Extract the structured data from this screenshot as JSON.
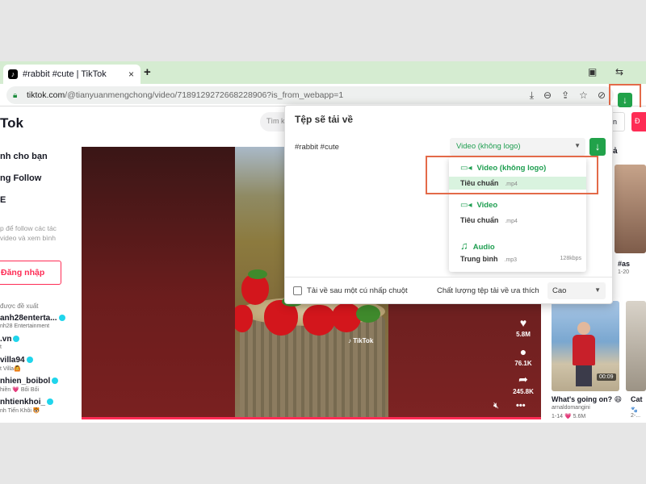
{
  "browser": {
    "tab_title": "#rabbit #cute | TikTok",
    "tab_close": "×",
    "new_tab": "+",
    "url_host": "tiktok.com",
    "url_path": "/@tianyuanmengchong/video/7189129272668228906?is_from_webapp=1"
  },
  "tiktok": {
    "logo": "Tok",
    "search_placeholder": "Tìm k",
    "btn1": "n",
    "btn2": "Đ",
    "nav": [
      "nh cho bạn",
      "ng Follow",
      "E"
    ],
    "hint_lines": [
      "p để follow các tác",
      " video và xem bình"
    ],
    "login": "Đăng nhập",
    "suggested_title": "được đề xuất",
    "accounts": [
      {
        "name": "anh28enterta...",
        "sub": "nh28 Entertainment"
      },
      {
        "name": ".vn",
        "sub": "t"
      },
      {
        "name": "villa94",
        "sub": "t Villa🙆"
      },
      {
        "name": "nhien_boibol",
        "sub": "hiền 💗 Bối Bối"
      },
      {
        "name": "nhtienkhoi_",
        "sub": "nh Tiến Khôi 🐯"
      }
    ],
    "video": {
      "watermark": "♪ TikTok",
      "likes": "5.8M",
      "comments": "76.1K",
      "shares": "245.8K"
    },
    "right": {
      "section_label": "ả",
      "caption1": "#as",
      "sub1": "1-20",
      "duration": "00:09",
      "caption2": "What's going on? 😄",
      "sub2": "arnaldomangini",
      "sub3": "1-14 💗 5.6M",
      "caption3": "Cat",
      "sub4": "🐾 2-..."
    }
  },
  "popup": {
    "title": "Tệp sẽ tải về",
    "file_name": "#rabbit #cute",
    "selected_format": "Video (không logo)",
    "options": [
      {
        "format": "Video (không logo)",
        "quality": "Tiêu chuẩn",
        "ext": ".mp4",
        "bitrate": ""
      },
      {
        "format": "Video",
        "quality": "Tiêu chuẩn",
        "ext": ".mp4",
        "bitrate": ""
      },
      {
        "format": "Audio",
        "quality": "Trung bình",
        "ext": ".mp3",
        "bitrate": "128kbps"
      }
    ],
    "one_click_label": "Tải về sau một cú nhấp chuột",
    "preferred_quality_label": "Chất lượng tệp tải về ưa thích",
    "preferred_quality_value": "Cao"
  },
  "colors": {
    "accent_green": "#21a24a",
    "tiktok_red": "#fe2c55",
    "highlight_orange": "#e36a49"
  }
}
